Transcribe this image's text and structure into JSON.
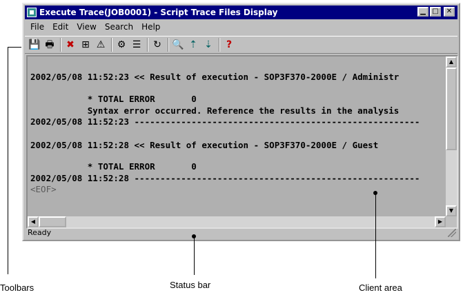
{
  "window": {
    "title": "Execute Trace(JOB0001) - Script Trace Files Display"
  },
  "menu": [
    "File",
    "Edit",
    "View",
    "Search",
    "Help"
  ],
  "toolbar": {
    "buttons": [
      {
        "name": "save-icon",
        "glyph": "💾"
      },
      {
        "name": "print-icon",
        "glyph": "🖶"
      },
      {
        "name": "delete-icon",
        "glyph": "✖"
      },
      {
        "name": "expand-icon",
        "glyph": "⊞"
      },
      {
        "name": "error-icon",
        "glyph": "⚠"
      },
      {
        "name": "search-settings-icon",
        "glyph": "⚙"
      },
      {
        "name": "list-icon",
        "glyph": "☰"
      },
      {
        "name": "refresh-icon",
        "glyph": "↻"
      },
      {
        "name": "find-icon",
        "glyph": "🔍"
      },
      {
        "name": "find-previous-icon",
        "glyph": "⇡"
      },
      {
        "name": "find-next-icon",
        "glyph": "⇣"
      },
      {
        "name": "help-icon",
        "glyph": "?"
      }
    ]
  },
  "content": {
    "lines": [
      "2002/05/08 11:52:23 << Result of execution - SOP3F370-2000E / Administr",
      "",
      "           * TOTAL ERROR       0",
      "           Syntax error occurred. Reference the results in the analysis",
      "2002/05/08 11:52:23 -------------------------------------------------------",
      "",
      "2002/05/08 11:52:28 << Result of execution - SOP3F370-2000E / Guest",
      "",
      "           * TOTAL ERROR       0",
      "2002/05/08 11:52:28 -------------------------------------------------------",
      "<EOF>"
    ]
  },
  "status": {
    "text": "Ready"
  },
  "callouts": {
    "toolbars": "Toolbars",
    "status_bar": "Status bar",
    "client_area": "Client area"
  }
}
